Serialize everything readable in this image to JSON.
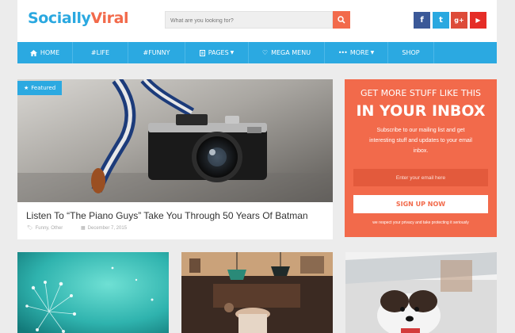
{
  "header": {
    "logo_part1": "Socially",
    "logo_part2": "Viral",
    "search_placeholder": "What are you looking for?",
    "social": [
      {
        "icon": "facebook-icon",
        "glyph": "f",
        "color": "#3b5998"
      },
      {
        "icon": "twitter-icon",
        "glyph": "t",
        "color": "#2aa8e0"
      },
      {
        "icon": "google-plus-icon",
        "glyph": "g+",
        "color": "#dd4b39"
      },
      {
        "icon": "youtube-icon",
        "glyph": "▶",
        "color": "#e52d27"
      }
    ]
  },
  "nav": {
    "items": [
      {
        "label": "HOME",
        "icon": "home-icon"
      },
      {
        "label": "#LIFE"
      },
      {
        "label": "#FUNNY"
      },
      {
        "label": "PAGES",
        "icon": "pages-icon",
        "dropdown": true
      },
      {
        "label": "MEGA MENU",
        "icon": "heart-icon"
      },
      {
        "label": "MORE",
        "icon": "more-icon",
        "dropdown": true
      },
      {
        "label": "SHOP"
      }
    ]
  },
  "featured": {
    "badge": "Featured",
    "title": "Listen To “The Piano Guys” Take You Through 50 Years Of Batman",
    "tags": "Funny, Other",
    "date": "December 7, 2015"
  },
  "subscribe": {
    "heading1": "GET MORE STUFF LIKE THIS",
    "heading2": "IN YOUR INBOX",
    "description": "Subscribe to our mailing list and get interesting stuff and updates to your email inbox.",
    "email_placeholder": "Enter your email here",
    "button_label": "SIGN UP NOW",
    "privacy_note": "we respect your privacy and take protecting it seriously"
  },
  "colors": {
    "accent_blue": "#2ba9e1",
    "accent_orange": "#f26a4b"
  }
}
